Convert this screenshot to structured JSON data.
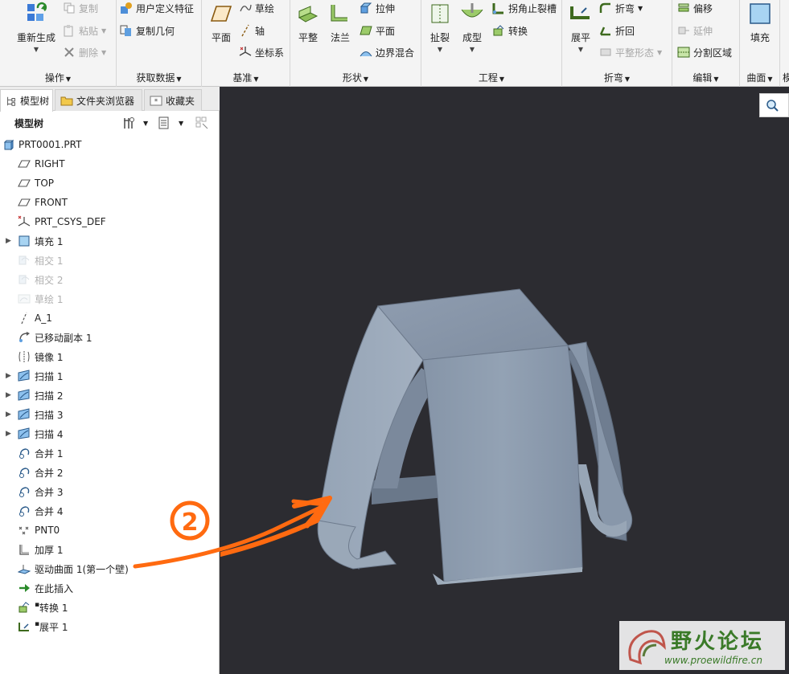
{
  "ribbon": {
    "g1": {
      "label": "操作",
      "regen": "重新生成",
      "copy": "复制",
      "paste": "粘贴",
      "delete": "删除"
    },
    "g2": {
      "label": "获取数据",
      "udf": "用户定义特征",
      "copy_geom": "复制几何"
    },
    "g3": {
      "label": "基准",
      "plane": "平面",
      "sketch": "草绘",
      "axis": "轴",
      "csys": "坐标系"
    },
    "g4": {
      "label": "形状",
      "flat": "平整",
      "flange": "法兰",
      "extrude": "拉伸",
      "plane2": "平面",
      "blend": "边界混合"
    },
    "g5": {
      "label": "工程",
      "rip": "扯裂",
      "form": "成型",
      "corner_relief": "拐角止裂槽",
      "convert": "转换"
    },
    "g6": {
      "label": "折弯",
      "unbend": "展平",
      "bend": "折弯",
      "bend_back": "折回",
      "flat_pattern": "平整形态"
    },
    "g7": {
      "label": "编辑",
      "offset": "偏移",
      "extend": "延伸",
      "split_area": "分割区域"
    },
    "g8": {
      "label": "曲面",
      "fill": "填充"
    },
    "g9": {
      "label": "模"
    }
  },
  "tabs": [
    "模型树",
    "文件夹浏览器",
    "收藏夹"
  ],
  "tree_header": "模型树",
  "tree": [
    {
      "label": "PRT0001.PRT",
      "icon": "part-icon",
      "expand": false,
      "dim": false
    },
    {
      "label": "RIGHT",
      "icon": "datum-plane-icon",
      "expand": false,
      "dim": false
    },
    {
      "label": "TOP",
      "icon": "datum-plane-icon",
      "expand": false,
      "dim": false
    },
    {
      "label": "FRONT",
      "icon": "datum-plane-icon",
      "expand": false,
      "dim": false
    },
    {
      "label": "PRT_CSYS_DEF",
      "icon": "csys-icon",
      "expand": false,
      "dim": false
    },
    {
      "label": "填充 1",
      "icon": "fill-icon",
      "expand": true,
      "dim": false
    },
    {
      "label": "相交 1",
      "icon": "intersect-icon",
      "expand": false,
      "dim": true
    },
    {
      "label": "相交 2",
      "icon": "intersect-icon",
      "expand": false,
      "dim": true
    },
    {
      "label": "草绘 1",
      "icon": "sketch-icon",
      "expand": false,
      "dim": true
    },
    {
      "label": "A_1",
      "icon": "axis-icon",
      "expand": false,
      "dim": false
    },
    {
      "label": "已移动副本 1",
      "icon": "moved-copy-icon",
      "expand": false,
      "dim": false
    },
    {
      "label": "镜像 1",
      "icon": "mirror-icon",
      "expand": false,
      "dim": false
    },
    {
      "label": "扫描 1",
      "icon": "sweep-icon",
      "expand": true,
      "dim": false
    },
    {
      "label": "扫描 2",
      "icon": "sweep-icon",
      "expand": true,
      "dim": false
    },
    {
      "label": "扫描 3",
      "icon": "sweep-icon",
      "expand": true,
      "dim": false
    },
    {
      "label": "扫描 4",
      "icon": "sweep-icon",
      "expand": true,
      "dim": false
    },
    {
      "label": "合并 1",
      "icon": "merge-icon",
      "expand": false,
      "dim": false
    },
    {
      "label": "合并 2",
      "icon": "merge-icon",
      "expand": false,
      "dim": false
    },
    {
      "label": "合并 3",
      "icon": "merge-icon",
      "expand": false,
      "dim": false
    },
    {
      "label": "合并 4",
      "icon": "merge-icon",
      "expand": false,
      "dim": false
    },
    {
      "label": "PNT0",
      "icon": "datum-point-icon",
      "expand": false,
      "dim": false
    },
    {
      "label": "加厚 1",
      "icon": "thicken-icon",
      "expand": false,
      "dim": false
    },
    {
      "label": "驱动曲面 1(第一个壁)",
      "icon": "driving-surface-icon",
      "expand": false,
      "dim": false
    },
    {
      "label": "在此插入",
      "icon": "insert-here-icon",
      "expand": false,
      "dim": false
    },
    {
      "label": "转换 1",
      "icon": "convert-icon",
      "expand": false,
      "dim": false
    },
    {
      "label": "展平 1",
      "icon": "unbend-icon",
      "expand": false,
      "dim": false
    }
  ],
  "annotation": {
    "number": "2",
    "color": "#ff6a10"
  },
  "watermark": {
    "text": "野火论坛",
    "url": "www.proewildfire.cn"
  },
  "colors": {
    "viewport_bg": "#2c2c31",
    "model": "#8c9bab"
  }
}
